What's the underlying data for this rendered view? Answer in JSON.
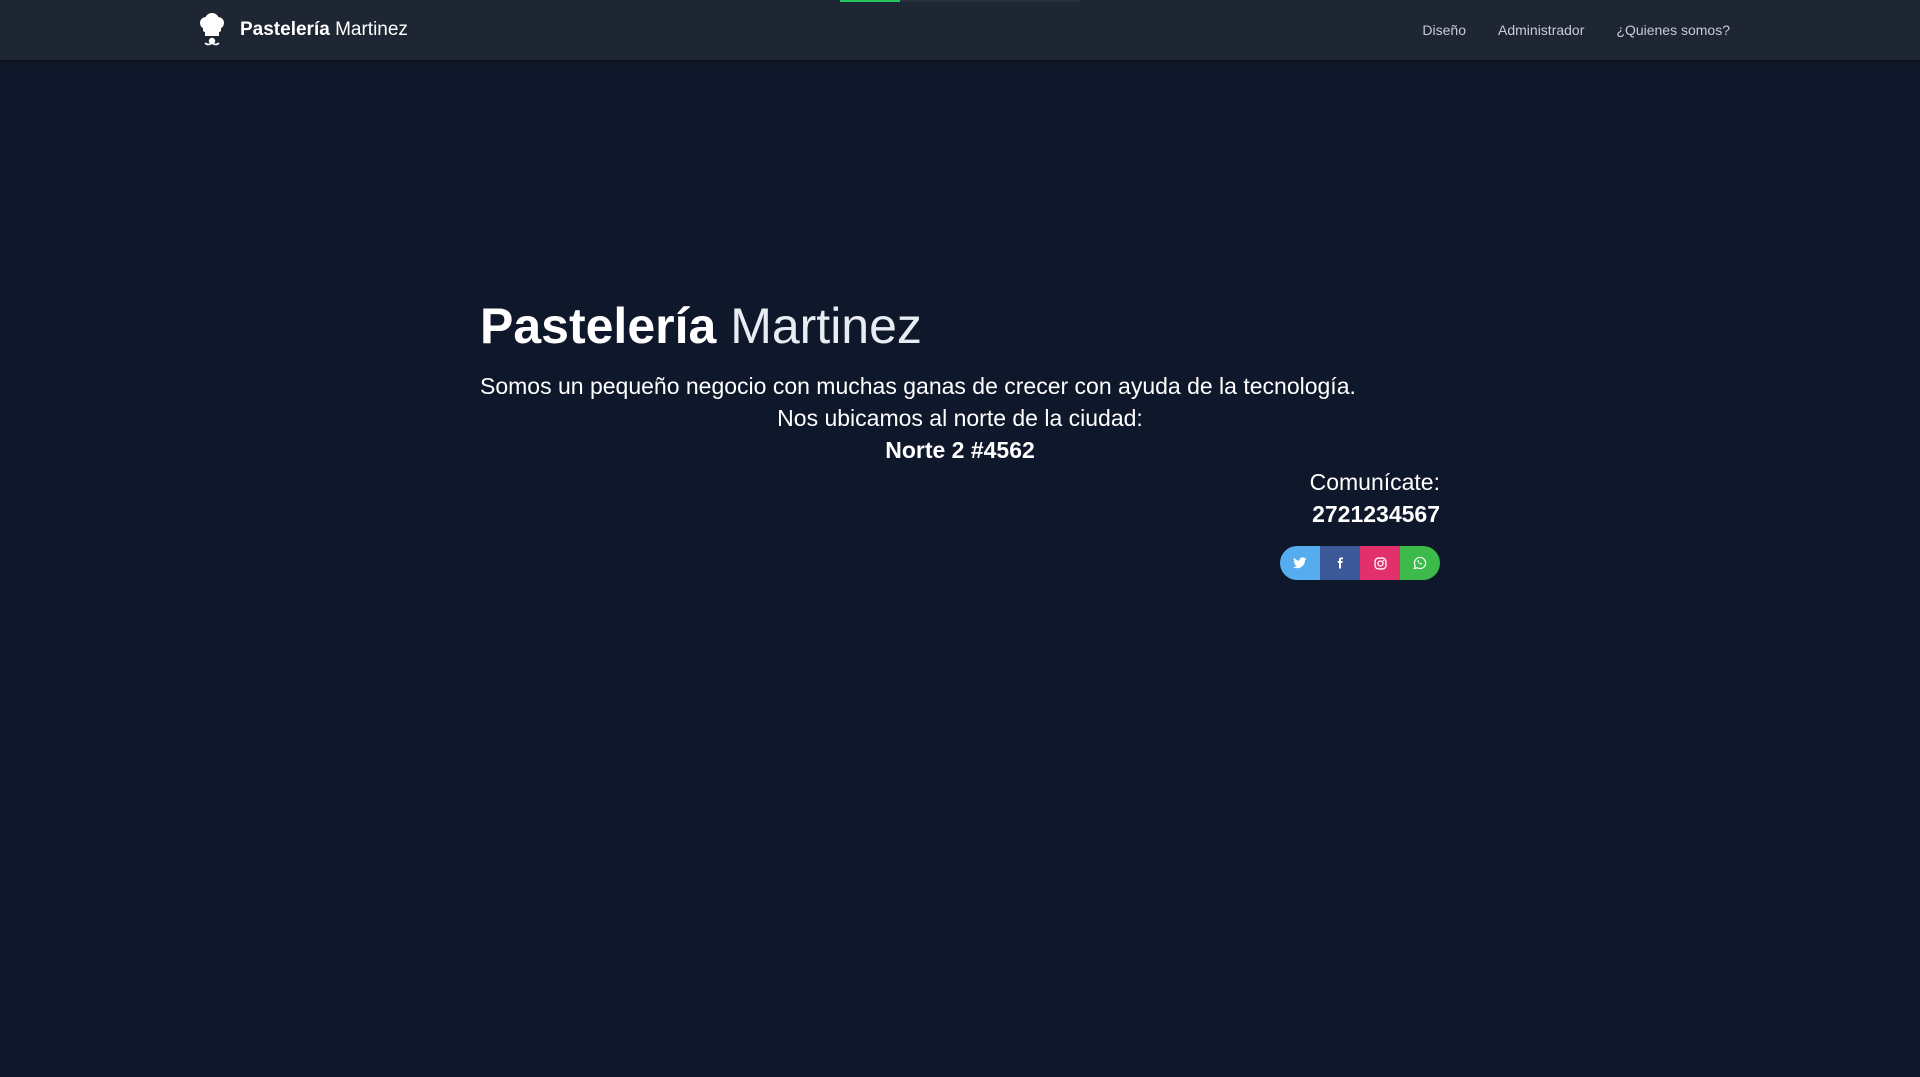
{
  "navbar": {
    "brand_bold": "Pastelería",
    "brand_light": "Martinez",
    "links": [
      "Diseño",
      "Administrador",
      "¿Quienes somos?"
    ],
    "loading_progress": 0.25
  },
  "hero": {
    "title_bold": "Pastelería",
    "title_light": "Martinez",
    "description": "Somos un pequeño negocio con muchas ganas de crecer con ayuda de la tecnología.",
    "location_intro": "Nos ubicamos al norte de la ciudad:",
    "address": "Norte 2 #4562",
    "contact_label": "Comunícate:",
    "phone": "2721234567"
  },
  "social": {
    "buttons": [
      {
        "icon": "twitter-icon",
        "color": "#55acee"
      },
      {
        "icon": "facebook-icon",
        "color": "#3b5998"
      },
      {
        "icon": "instagram-icon",
        "color": "#e1306c"
      },
      {
        "icon": "whatsapp-icon",
        "color": "#3dbb4a"
      }
    ]
  },
  "colors": {
    "background": "#0f172a",
    "navbar": "#1e2533",
    "accent": "#22c55e"
  }
}
